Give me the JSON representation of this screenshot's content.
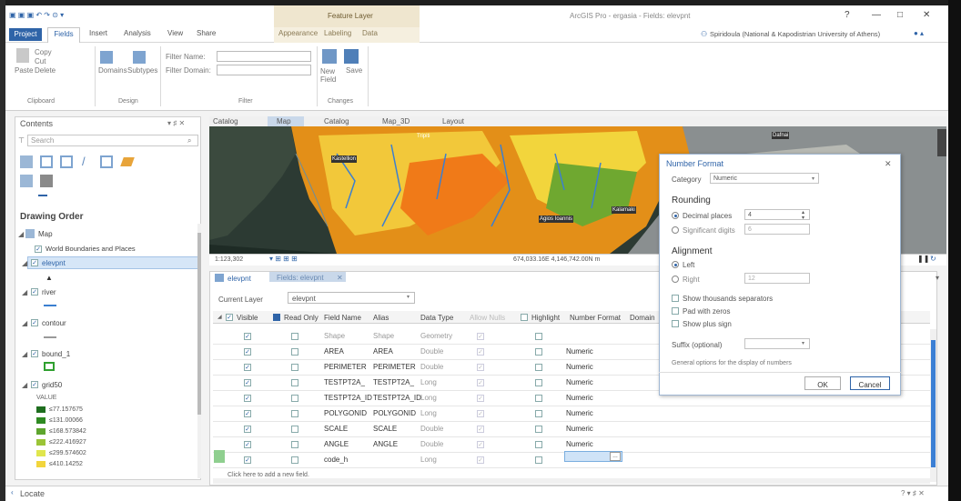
{
  "title_bar": {
    "context_tab": "Feature Layer",
    "app_title": "ArcGIS Pro - ergasia - Fields: elevpnt",
    "help": "?",
    "minimize": "—",
    "maximize": "□",
    "close": "✕"
  },
  "ribbon_tabs": [
    "Project",
    "Fields",
    "Insert",
    "Analysis",
    "View",
    "Share",
    "Appearance",
    "Labeling",
    "Data"
  ],
  "signin": "Spiridoula (National & Kapodistrian University of Athens)",
  "ribbon": {
    "clipboard": {
      "paste": "Paste",
      "copy": "Copy",
      "cut": "Cut",
      "delete": "Delete",
      "group": "Clipboard"
    },
    "design": {
      "domains": "Domains",
      "subtypes": "Subtypes",
      "group": "Design"
    },
    "filter": {
      "name_label": "Filter Name:",
      "domain_label": "Filter Domain:",
      "name_value": "",
      "domain_value": "",
      "group": "Filter"
    },
    "changes": {
      "new_field": "New Field",
      "save": "Save",
      "group": "Changes"
    }
  },
  "contents": {
    "title": "Contents",
    "pin": "▾ ♯ ✕",
    "search_placeholder": "Search",
    "drawing_order": "Drawing Order",
    "map": "Map",
    "layers": [
      {
        "name": "World Boundaries and Places",
        "checked": true
      },
      {
        "name": "elevpnt",
        "checked": true
      },
      {
        "name": "river",
        "checked": true
      },
      {
        "name": "contour",
        "checked": true
      },
      {
        "name": "bound_1",
        "checked": true
      },
      {
        "name": "grid50",
        "checked": true
      }
    ],
    "value_label": "VALUE",
    "legend": [
      {
        "label": "≤77.157675",
        "color": "#1f6e1f"
      },
      {
        "label": "≤131.00066",
        "color": "#2f8a22"
      },
      {
        "label": "≤168.573842",
        "color": "#5ea52e"
      },
      {
        "label": "≤222.416927",
        "color": "#9bc437"
      },
      {
        "label": "≤299.574602",
        "color": "#e0e64d"
      },
      {
        "label": "≤410.14252",
        "color": "#f2d53c"
      }
    ]
  },
  "map_tabs": [
    "Catalog",
    "Map",
    "Catalog",
    "Map_3D",
    "Layout"
  ],
  "map_status": {
    "scale": "1:123,302",
    "coords": "674,033.16E 4,146,742.00N m"
  },
  "map_labels": [
    "Kastellion",
    "Tripiti",
    "Agios Ioannis",
    "Kalamaki",
    "Dafnai"
  ],
  "fields_view": {
    "tabs": [
      "elevpnt",
      "Fields: elevpnt"
    ],
    "current_layer_label": "Current Layer",
    "current_layer_value": "elevpnt",
    "columns": [
      "Visible",
      "Read Only",
      "Field Name",
      "Alias",
      "Data Type",
      "Allow Nulls",
      "Highlight",
      "Number Format",
      "Domain"
    ],
    "rows": [
      {
        "visible": true,
        "readonly": false,
        "name": "Shape",
        "alias": "Shape",
        "type": "Geometry",
        "nulls": true,
        "highlight": false,
        "format": ""
      },
      {
        "visible": true,
        "readonly": false,
        "name": "AREA",
        "alias": "AREA",
        "type": "Double",
        "nulls": true,
        "highlight": false,
        "format": "Numeric"
      },
      {
        "visible": true,
        "readonly": false,
        "name": "PERIMETER",
        "alias": "PERIMETER",
        "type": "Double",
        "nulls": true,
        "highlight": false,
        "format": "Numeric"
      },
      {
        "visible": true,
        "readonly": false,
        "name": "TESTPT2A_",
        "alias": "TESTPT2A_",
        "type": "Long",
        "nulls": true,
        "highlight": false,
        "format": "Numeric"
      },
      {
        "visible": true,
        "readonly": false,
        "name": "TESTPT2A_ID",
        "alias": "TESTPT2A_ID",
        "type": "Long",
        "nulls": true,
        "highlight": false,
        "format": "Numeric"
      },
      {
        "visible": true,
        "readonly": false,
        "name": "POLYGONID",
        "alias": "POLYGONID",
        "type": "Long",
        "nulls": true,
        "highlight": false,
        "format": "Numeric"
      },
      {
        "visible": true,
        "readonly": false,
        "name": "SCALE",
        "alias": "SCALE",
        "type": "Double",
        "nulls": true,
        "highlight": false,
        "format": "Numeric"
      },
      {
        "visible": true,
        "readonly": false,
        "name": "ANGLE",
        "alias": "ANGLE",
        "type": "Double",
        "nulls": true,
        "highlight": false,
        "format": "Numeric"
      },
      {
        "visible": true,
        "readonly": false,
        "name": "code_h",
        "alias": "",
        "type": "Long",
        "nulls": true,
        "highlight": false,
        "format": ""
      }
    ],
    "add_field": "Click here to add a new field."
  },
  "number_format": {
    "title": "Number Format",
    "category_label": "Category",
    "category_value": "Numeric",
    "rounding": "Rounding",
    "decimal_places": "Decimal places",
    "decimal_value": "4",
    "significant_digits": "Significant digits",
    "significant_value": "6",
    "alignment": "Alignment",
    "left": "Left",
    "right": "Right",
    "right_value": "12",
    "show_thousands": "Show thousands separators",
    "pad_zeros": "Pad with zeros",
    "show_plus": "Show plus sign",
    "suffix_label": "Suffix (optional)",
    "general": "General options for the display of numbers",
    "ok": "OK",
    "cancel": "Cancel"
  },
  "bottom": {
    "locate": "Locate",
    "controls": "? ▾ ♯ ✕"
  }
}
